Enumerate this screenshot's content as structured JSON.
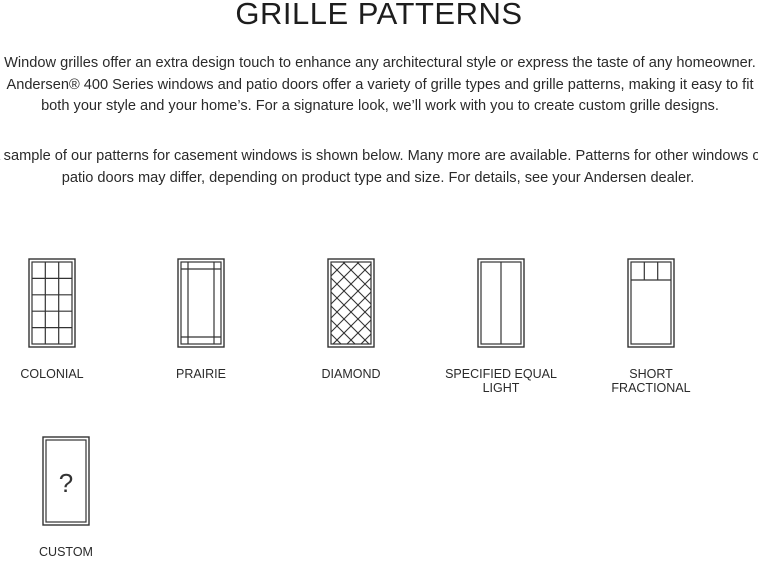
{
  "page": {
    "title": "GRILLE PATTERNS",
    "paragraph_1": "Window grilles offer an extra design touch to enhance any architectural style or express the taste of any homeowner. Andersen® 400 Series windows and patio doors offer a variety of grille types and grille patterns, making it easy to fit both your style and your home’s. For a signature look, we’ll work with you to create custom grille designs.",
    "paragraph_2": "A sample of our patterns for casement windows is shown below. Many more are available. Patterns for other windows or patio doors may differ, depending on product type and size. For details, see your Andersen dealer."
  },
  "patterns": [
    {
      "label": "COLONIAL",
      "icon": "colonial-grille-icon"
    },
    {
      "label": "PRAIRIE",
      "icon": "prairie-grille-icon"
    },
    {
      "label": "DIAMOND",
      "icon": "diamond-grille-icon"
    },
    {
      "label": "SPECIFIED EQUAL LIGHT",
      "icon": "specified-equal-light-grille-icon"
    },
    {
      "label": "SHORT FRACTIONAL",
      "icon": "short-fractional-grille-icon"
    },
    {
      "label": "CUSTOM",
      "icon": "custom-grille-icon",
      "glyph": "?"
    }
  ],
  "colors": {
    "line": "#333333",
    "text": "#222222",
    "background": "#ffffff"
  }
}
